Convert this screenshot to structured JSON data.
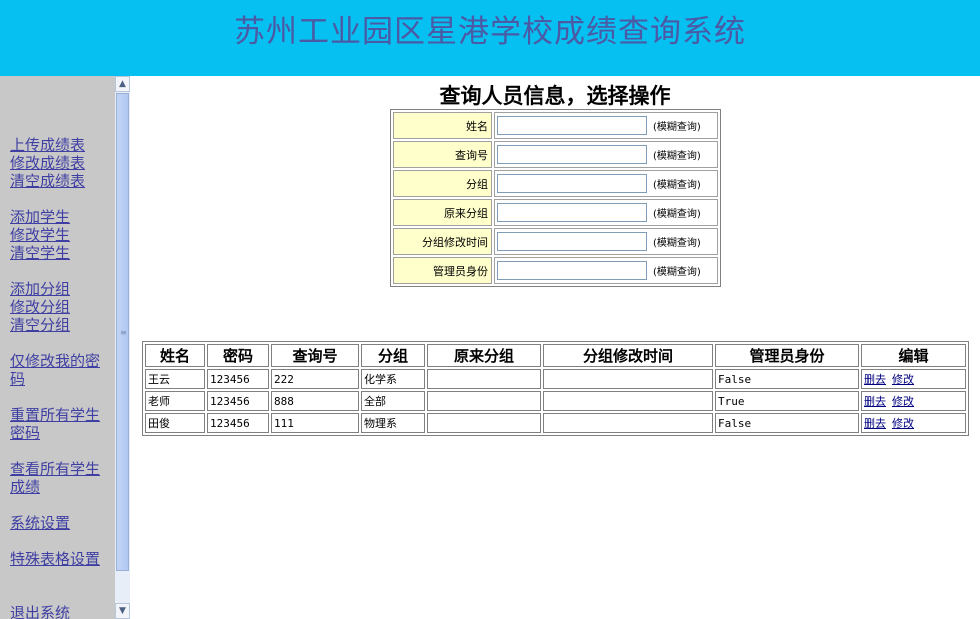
{
  "header": {
    "title": "苏州工业园区星港学校成绩查询系统"
  },
  "sidebar": {
    "groups": [
      [
        "上传成绩表",
        "修改成绩表",
        "清空成绩表"
      ],
      [
        "添加学生",
        "修改学生",
        "清空学生"
      ],
      [
        "添加分组",
        "修改分组",
        "清空分组"
      ],
      [
        "仅修改我的密码"
      ],
      [
        "重置所有学生密码"
      ],
      [
        "查看所有学生成绩"
      ],
      [
        "系统设置"
      ],
      [
        "特殊表格设置"
      ],
      [
        "退出系统"
      ]
    ]
  },
  "scrollbar": {
    "up_glyph": "▲",
    "down_glyph": "▼",
    "grip_glyph": "≡"
  },
  "search": {
    "heading": "查询人员信息，选择操作",
    "hint": "(模糊查询)",
    "fields": [
      {
        "label": "姓名",
        "value": ""
      },
      {
        "label": "查询号",
        "value": ""
      },
      {
        "label": "分组",
        "value": ""
      },
      {
        "label": "原来分组",
        "value": ""
      },
      {
        "label": "分组修改时间",
        "value": ""
      },
      {
        "label": "管理员身份",
        "value": ""
      }
    ]
  },
  "table": {
    "headers": [
      "姓名",
      "密码",
      "查询号",
      "分组",
      "原来分组",
      "分组修改时间",
      "管理员身份",
      "编辑"
    ],
    "rows": [
      {
        "name": "王云",
        "password": "123456",
        "query_no": "222",
        "group": "化学系",
        "original_group": "",
        "group_changed": "",
        "admin": "False"
      },
      {
        "name": "老师",
        "password": "123456",
        "query_no": "888",
        "group": "全部",
        "original_group": "",
        "group_changed": "",
        "admin": "True"
      },
      {
        "name": "田俊",
        "password": "123456",
        "query_no": "111",
        "group": "物理系",
        "original_group": "",
        "group_changed": "",
        "admin": "False"
      }
    ],
    "actions": {
      "delete": "删去",
      "edit": "修改"
    }
  }
}
